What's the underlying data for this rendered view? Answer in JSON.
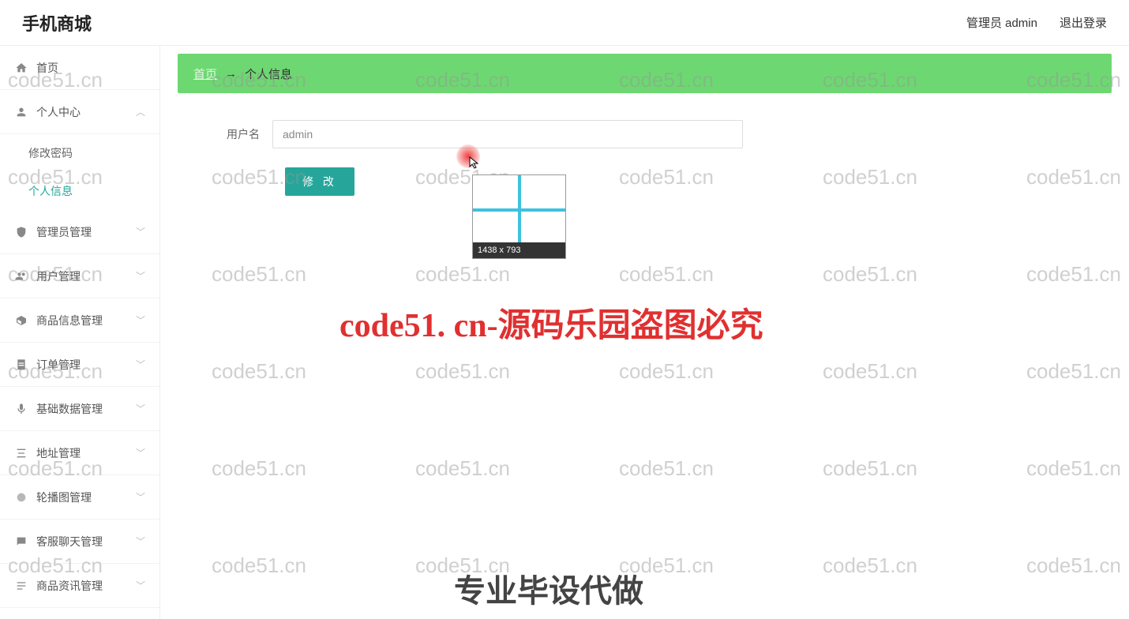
{
  "header": {
    "logo": "手机商城",
    "admin_label": "管理员 admin",
    "logout_label": "退出登录"
  },
  "sidebar": {
    "home": "首页",
    "personal_center": "个人中心",
    "sub_change_pwd": "修改密码",
    "sub_personal_info": "个人信息",
    "admin_mgmt": "管理员管理",
    "user_mgmt": "用户管理",
    "product_info_mgmt": "商品信息管理",
    "order_mgmt": "订单管理",
    "base_data_mgmt": "基础数据管理",
    "address_mgmt": "地址管理",
    "carousel_mgmt": "轮播图管理",
    "chat_mgmt": "客服聊天管理",
    "news_mgmt": "商品资讯管理"
  },
  "breadcrumb": {
    "home": "首页",
    "arrow": "→",
    "current": "个人信息"
  },
  "form": {
    "username_label": "用户名",
    "username_value": "admin",
    "submit_label": "修 改"
  },
  "overlay": {
    "zoom_dims": "1438 x 793",
    "big_text": "code51. cn-源码乐园盗图必究",
    "big_text2": "专业毕设代做",
    "watermark": "code51.cn"
  }
}
